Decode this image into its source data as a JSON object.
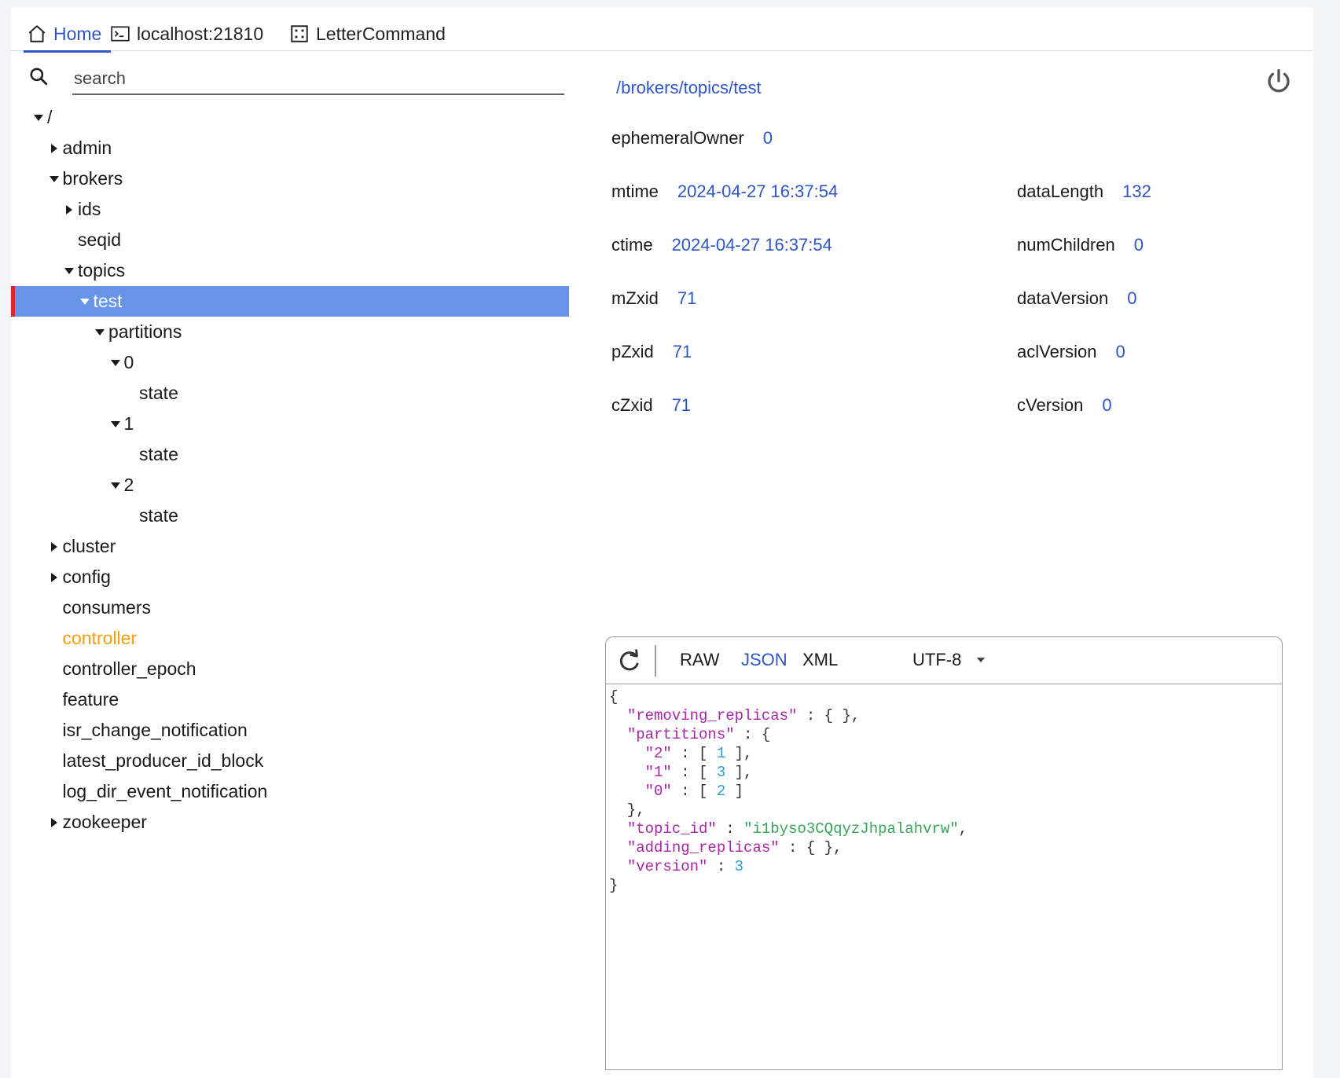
{
  "tabs": [
    {
      "label": "Home",
      "icon": "home-icon"
    },
    {
      "label": "localhost:21810",
      "icon": "terminal-icon"
    },
    {
      "label": "LetterCommand",
      "icon": "dice-icon"
    }
  ],
  "search": {
    "placeholder": "search"
  },
  "tree": [
    {
      "label": "/",
      "state": "expanded"
    },
    {
      "label": "admin",
      "state": "collapsed"
    },
    {
      "label": "brokers",
      "state": "expanded"
    },
    {
      "label": "ids",
      "state": "collapsed"
    },
    {
      "label": "seqid",
      "state": "leaf"
    },
    {
      "label": "topics",
      "state": "expanded"
    },
    {
      "label": "test",
      "state": "expanded",
      "selected": true
    },
    {
      "label": "partitions",
      "state": "expanded"
    },
    {
      "label": "0",
      "state": "expanded"
    },
    {
      "label": "state",
      "state": "leaf"
    },
    {
      "label": "1",
      "state": "expanded"
    },
    {
      "label": "state",
      "state": "leaf"
    },
    {
      "label": "2",
      "state": "expanded"
    },
    {
      "label": "state",
      "state": "leaf"
    },
    {
      "label": "cluster",
      "state": "collapsed"
    },
    {
      "label": "config",
      "state": "collapsed"
    },
    {
      "label": "consumers",
      "state": "leaf"
    },
    {
      "label": "controller",
      "state": "leaf",
      "highlight": true
    },
    {
      "label": "controller_epoch",
      "state": "leaf"
    },
    {
      "label": "feature",
      "state": "leaf"
    },
    {
      "label": "isr_change_notification",
      "state": "leaf"
    },
    {
      "label": "latest_producer_id_block",
      "state": "leaf"
    },
    {
      "label": "log_dir_event_notification",
      "state": "leaf"
    },
    {
      "label": "zookeeper",
      "state": "collapsed"
    }
  ],
  "details": {
    "path": "/brokers/topics/test",
    "ephemeralOwner": {
      "label": "ephemeralOwner",
      "value": "0"
    },
    "mtime": {
      "label": "mtime",
      "value": "2024-04-27 16:37:54"
    },
    "ctime": {
      "label": "ctime",
      "value": "2024-04-27 16:37:54"
    },
    "mZxid": {
      "label": "mZxid",
      "value": "71"
    },
    "pZxid": {
      "label": "pZxid",
      "value": "71"
    },
    "cZxid": {
      "label": "cZxid",
      "value": "71"
    },
    "dataLength": {
      "label": "dataLength",
      "value": "132"
    },
    "numChildren": {
      "label": "numChildren",
      "value": "0"
    },
    "dataVersion": {
      "label": "dataVersion",
      "value": "0"
    },
    "aclVersion": {
      "label": "aclVersion",
      "value": "0"
    },
    "cVersion": {
      "label": "cVersion",
      "value": "0"
    }
  },
  "editor": {
    "formats": [
      "RAW",
      "JSON",
      "XML"
    ],
    "active_format": "JSON",
    "encoding": "UTF-8",
    "content": [
      [
        {
          "t": "{",
          "c": "p"
        }
      ],
      [
        {
          "t": "  ",
          "c": "p"
        },
        {
          "t": "\"removing_replicas\"",
          "c": "key"
        },
        {
          "t": " : { },",
          "c": "p"
        }
      ],
      [
        {
          "t": "  ",
          "c": "p"
        },
        {
          "t": "\"partitions\"",
          "c": "key"
        },
        {
          "t": " : {",
          "c": "p"
        }
      ],
      [
        {
          "t": "    ",
          "c": "p"
        },
        {
          "t": "\"2\"",
          "c": "key"
        },
        {
          "t": " : [ ",
          "c": "p"
        },
        {
          "t": "1",
          "c": "num"
        },
        {
          "t": " ],",
          "c": "p"
        }
      ],
      [
        {
          "t": "    ",
          "c": "p"
        },
        {
          "t": "\"1\"",
          "c": "key"
        },
        {
          "t": " : [ ",
          "c": "p"
        },
        {
          "t": "3",
          "c": "num"
        },
        {
          "t": " ],",
          "c": "p"
        }
      ],
      [
        {
          "t": "    ",
          "c": "p"
        },
        {
          "t": "\"0\"",
          "c": "key"
        },
        {
          "t": " : [ ",
          "c": "p"
        },
        {
          "t": "2",
          "c": "num"
        },
        {
          "t": " ]",
          "c": "p"
        }
      ],
      [
        {
          "t": "  },",
          "c": "p"
        }
      ],
      [
        {
          "t": "  ",
          "c": "p"
        },
        {
          "t": "\"topic_id\"",
          "c": "key"
        },
        {
          "t": " : ",
          "c": "p"
        },
        {
          "t": "\"i1byso3CQqyzJhpalahvrw\"",
          "c": "str"
        },
        {
          "t": ",",
          "c": "p"
        }
      ],
      [
        {
          "t": "  ",
          "c": "p"
        },
        {
          "t": "\"adding_replicas\"",
          "c": "key"
        },
        {
          "t": " : { },",
          "c": "p"
        }
      ],
      [
        {
          "t": "  ",
          "c": "p"
        },
        {
          "t": "\"version\"",
          "c": "key"
        },
        {
          "t": " : ",
          "c": "p"
        },
        {
          "t": "3",
          "c": "num"
        }
      ],
      [
        {
          "t": "}",
          "c": "p"
        }
      ]
    ]
  }
}
